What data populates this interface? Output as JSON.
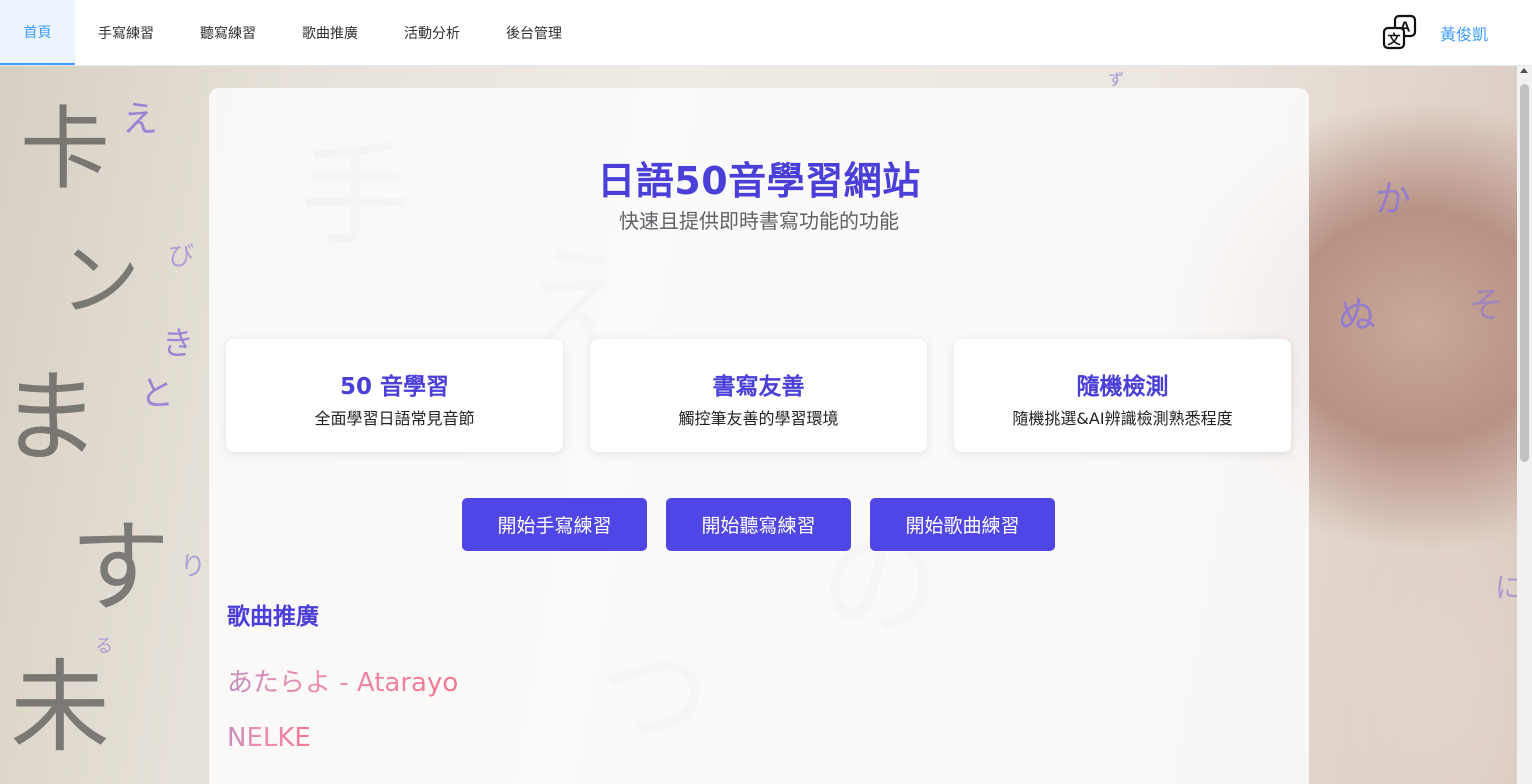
{
  "nav": {
    "items": [
      {
        "label": "首頁",
        "active": true
      },
      {
        "label": "手寫練習",
        "active": false
      },
      {
        "label": "聽寫練習",
        "active": false
      },
      {
        "label": "歌曲推廣",
        "active": false
      },
      {
        "label": "活動分析",
        "active": false
      },
      {
        "label": "後台管理",
        "active": false
      }
    ],
    "translate_icon": "translate-icon",
    "user": "黃俊凱"
  },
  "hero": {
    "title": "日語50音學習網站",
    "subtitle": "快速且提供即時書寫功能的功能"
  },
  "features": [
    {
      "title": "50 音學習",
      "desc": "全面學習日語常見音節"
    },
    {
      "title": "書寫友善",
      "desc": "觸控筆友善的學習環境"
    },
    {
      "title": "隨機檢測",
      "desc": "隨機挑選&AI辨識檢測熟悉程度"
    }
  ],
  "buttons": {
    "handwriting": "開始手寫練習",
    "dictation": "開始聽寫練習",
    "song": "開始歌曲練習"
  },
  "songs": {
    "heading": "歌曲推廣",
    "items": [
      "あたらよ - Atarayo",
      "NELKE"
    ]
  },
  "colors": {
    "accent": "#4f46e5",
    "nav_active": "#409eff",
    "heading": "#4a3fd8"
  }
}
